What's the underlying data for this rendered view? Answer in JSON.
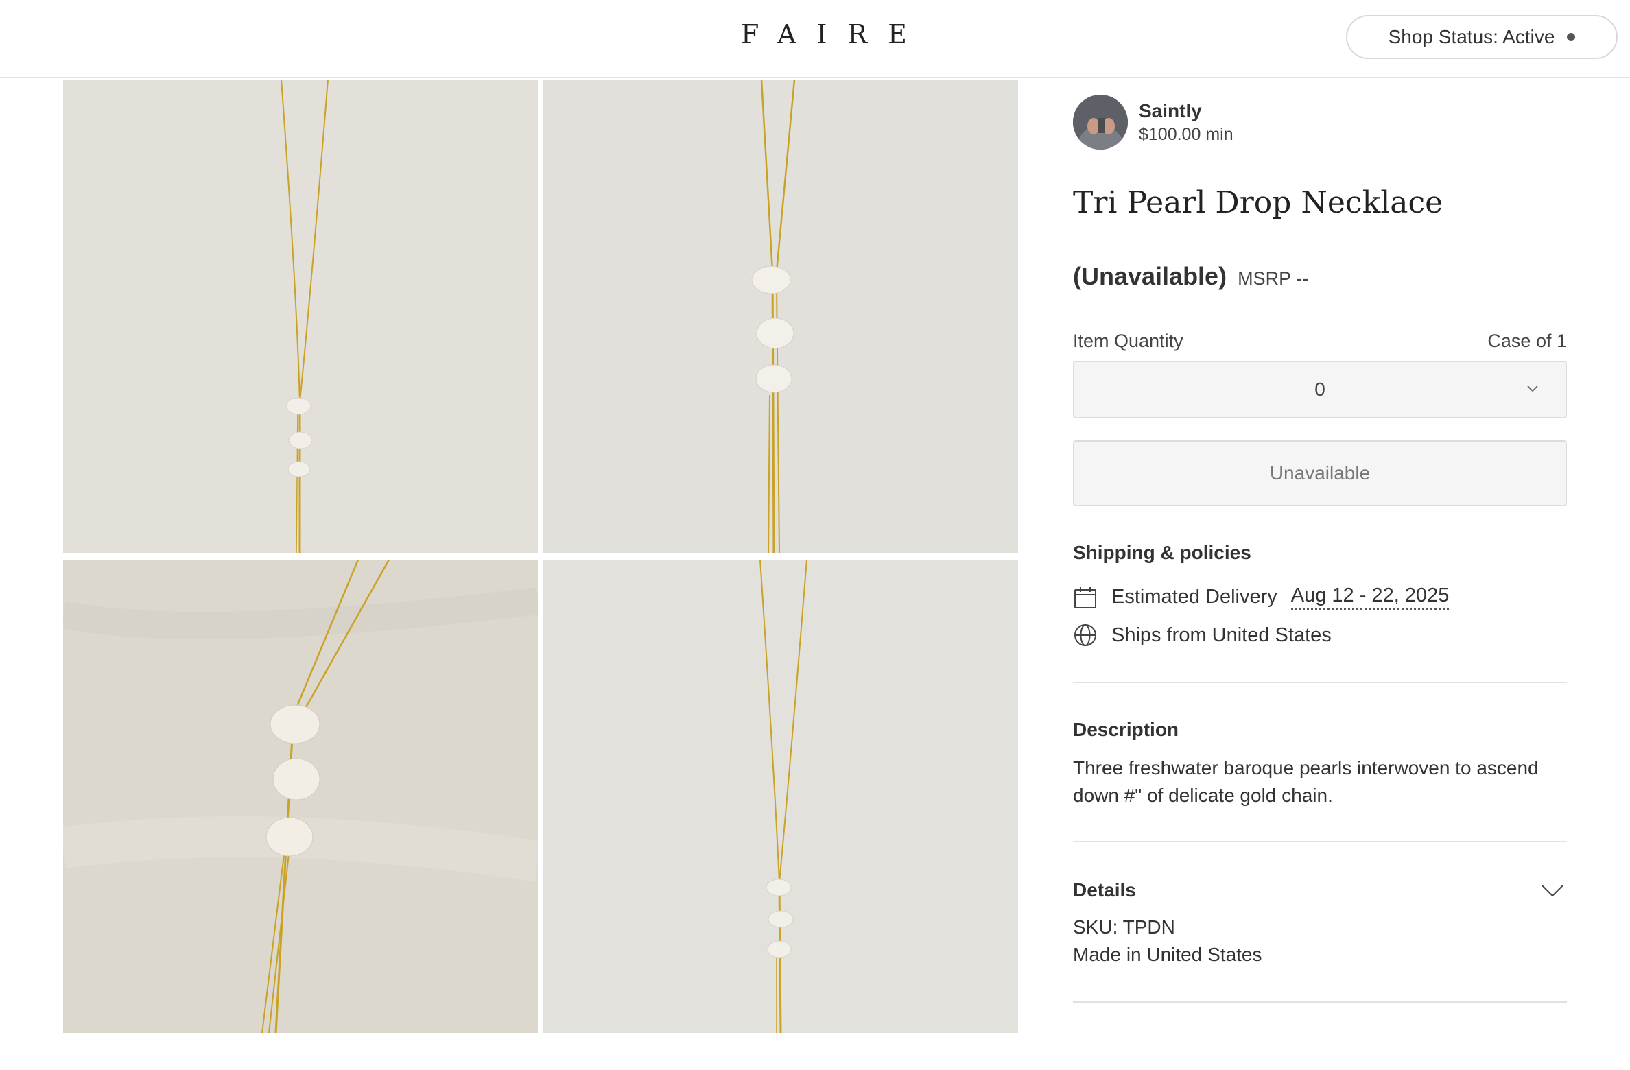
{
  "header": {
    "logo": "FAIRE",
    "shop_status": "Shop Status: Active"
  },
  "gallery": {
    "images": [
      {
        "alt": "necklace-photo-1"
      },
      {
        "alt": "necklace-photo-2"
      },
      {
        "alt": "necklace-photo-3"
      },
      {
        "alt": "necklace-photo-4"
      }
    ]
  },
  "shop": {
    "name": "Saintly",
    "minimum": "$100.00 min"
  },
  "product": {
    "title": "Tri Pearl Drop Necklace",
    "price": "(Unavailable)",
    "msrp": "MSRP --",
    "quantity_label": "Item Quantity",
    "case_label": "Case of 1",
    "quantity_value": "0",
    "add_button": "Unavailable"
  },
  "shipping": {
    "title": "Shipping & policies",
    "delivery_label": "Estimated Delivery",
    "delivery_dates": "Aug 12 - 22, 2025",
    "ships_from": "Ships from United States"
  },
  "description": {
    "title": "Description",
    "text": "Three freshwater baroque pearls interwoven to ascend down #\" of delicate gold chain."
  },
  "details": {
    "title": "Details",
    "sku": "SKU: TPDN",
    "made_in": "Made in United States"
  },
  "colors": {
    "gold_chain": "#c9a227",
    "pearl": "#f4f1ea",
    "linen": "#e3e0d9"
  },
  "icons": [
    "calendar-icon",
    "globe-icon",
    "chevron-down-icon",
    "status-dot"
  ]
}
